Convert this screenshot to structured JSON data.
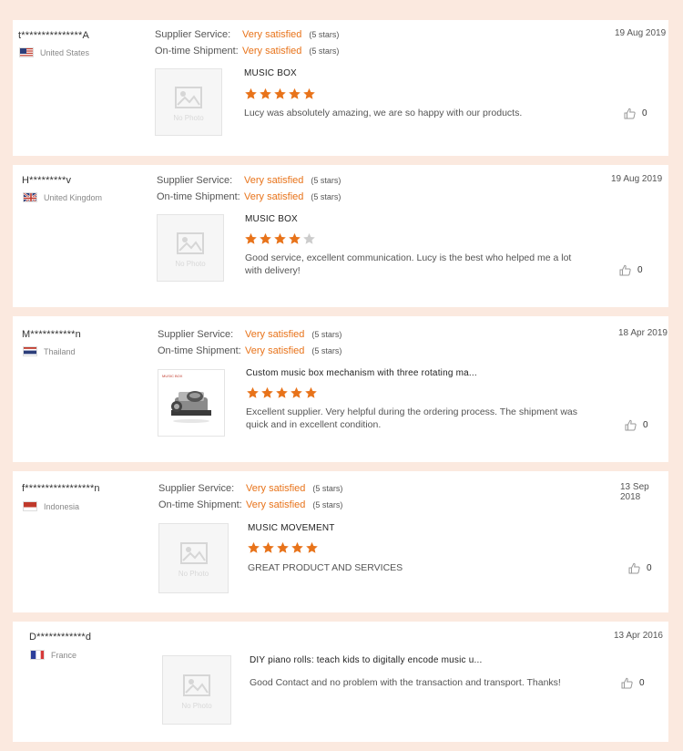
{
  "labels": {
    "supplier_service": "Supplier Service:",
    "ontime_shipment": "On-time Shipment:",
    "no_photo": "No Photo"
  },
  "colors": {
    "accent": "#e8731a",
    "star_empty": "#cccccc",
    "background": "#fbe9df"
  },
  "reviews": [
    {
      "reviewer": "t***************A",
      "country": "United States",
      "flag": "us-flag-icon",
      "date": "19 Aug 2019",
      "supplier_value": "Very satisfied",
      "supplier_stars": "(5 stars)",
      "shipment_value": "Very satisfied",
      "shipment_stars": "(5 stars)",
      "product": "MUSIC BOX",
      "rating": 5,
      "comment_lines": [
        "Lucy was absolutely amazing, we are so happy with our products."
      ],
      "likes": "0",
      "image": "no-photo"
    },
    {
      "reviewer": "H*********v",
      "country": "United Kingdom",
      "flag": "uk-flag-icon",
      "date": "19 Aug 2019",
      "supplier_value": "Very satisfied",
      "supplier_stars": "(5 stars)",
      "shipment_value": "Very satisfied",
      "shipment_stars": "(5 stars)",
      "product": "MUSIC BOX",
      "rating": 4,
      "comment_lines": [
        "Good service, excellent communication. Lucy is the best who helped me a lot",
        "with delivery!"
      ],
      "likes": "0",
      "image": "no-photo"
    },
    {
      "reviewer": "M***********n",
      "country": "Thailand",
      "flag": "thailand-flag-icon",
      "date": "18 Apr 2019",
      "supplier_value": "Very satisfied",
      "supplier_stars": "(5 stars)",
      "shipment_value": "Very satisfied",
      "shipment_stars": "(5 stars)",
      "product": "Custom music box mechanism with three rotating ma...",
      "rating": 5,
      "comment_lines": [
        "Excellent supplier. Very helpful during the ordering process. The shipment was",
        "quick and  in excellent condition."
      ],
      "likes": "0",
      "image": "product-photo"
    },
    {
      "reviewer": "f*****************n",
      "country": "Indonesia",
      "flag": "indonesia-flag-icon",
      "date": "13 Sep 2018",
      "supplier_value": "Very satisfied",
      "supplier_stars": "(5 stars)",
      "shipment_value": "Very satisfied",
      "shipment_stars": "(5 stars)",
      "product": "MUSIC MOVEMENT",
      "rating": 5,
      "comment_lines": [
        "GREAT PRODUCT AND SERVICES"
      ],
      "likes": "0",
      "image": "no-photo"
    },
    {
      "reviewer": "D************d",
      "country": "France",
      "flag": "france-flag-icon",
      "date": "13 Apr 2016",
      "product": "DIY piano rolls: teach kids to digitally encode music u...",
      "rating": 0,
      "comment_lines": [
        "Good Contact and no problem with the transaction and transport. Thanks!"
      ],
      "likes": "0",
      "image": "no-photo"
    }
  ]
}
